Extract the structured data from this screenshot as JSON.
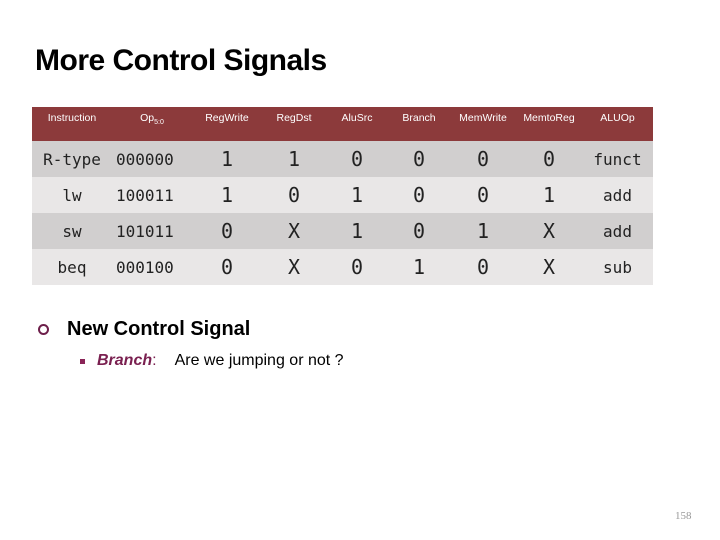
{
  "title": "More Control Signals",
  "table": {
    "headers": {
      "instruction": "Instruction",
      "op": "Op",
      "op_sub": "5:0",
      "regwrite": "RegWrite",
      "regdst": "RegDst",
      "alusrc": "AluSrc",
      "branch": "Branch",
      "memwrite": "MemWrite",
      "memtoreg": "MemtoReg",
      "aluop": "ALUOp"
    },
    "rows": [
      {
        "instruction": "R-type",
        "op": "000000",
        "regwrite": "1",
        "regdst": "1",
        "alusrc": "0",
        "branch": "0",
        "memwrite": "0",
        "memtoreg": "0",
        "aluop": "funct"
      },
      {
        "instruction": "lw",
        "op": "100011",
        "regwrite": "1",
        "regdst": "0",
        "alusrc": "1",
        "branch": "0",
        "memwrite": "0",
        "memtoreg": "1",
        "aluop": "add"
      },
      {
        "instruction": "sw",
        "op": "101011",
        "regwrite": "0",
        "regdst": "X",
        "alusrc": "1",
        "branch": "0",
        "memwrite": "1",
        "memtoreg": "X",
        "aluop": "add"
      },
      {
        "instruction": "beq",
        "op": "000100",
        "regwrite": "0",
        "regdst": "X",
        "alusrc": "0",
        "branch": "1",
        "memwrite": "0",
        "memtoreg": "X",
        "aluop": "sub"
      }
    ]
  },
  "bullets": {
    "level1": "New Control Signal",
    "level2_term": "Branch",
    "level2_colon": ":",
    "level2_text": "Are we jumping or not ?"
  },
  "page_number": "158",
  "colors": {
    "header_bg": "#8c3a3b",
    "row_odd": "#d1cfcf",
    "row_even": "#e9e7e7",
    "accent": "#7a2050"
  }
}
